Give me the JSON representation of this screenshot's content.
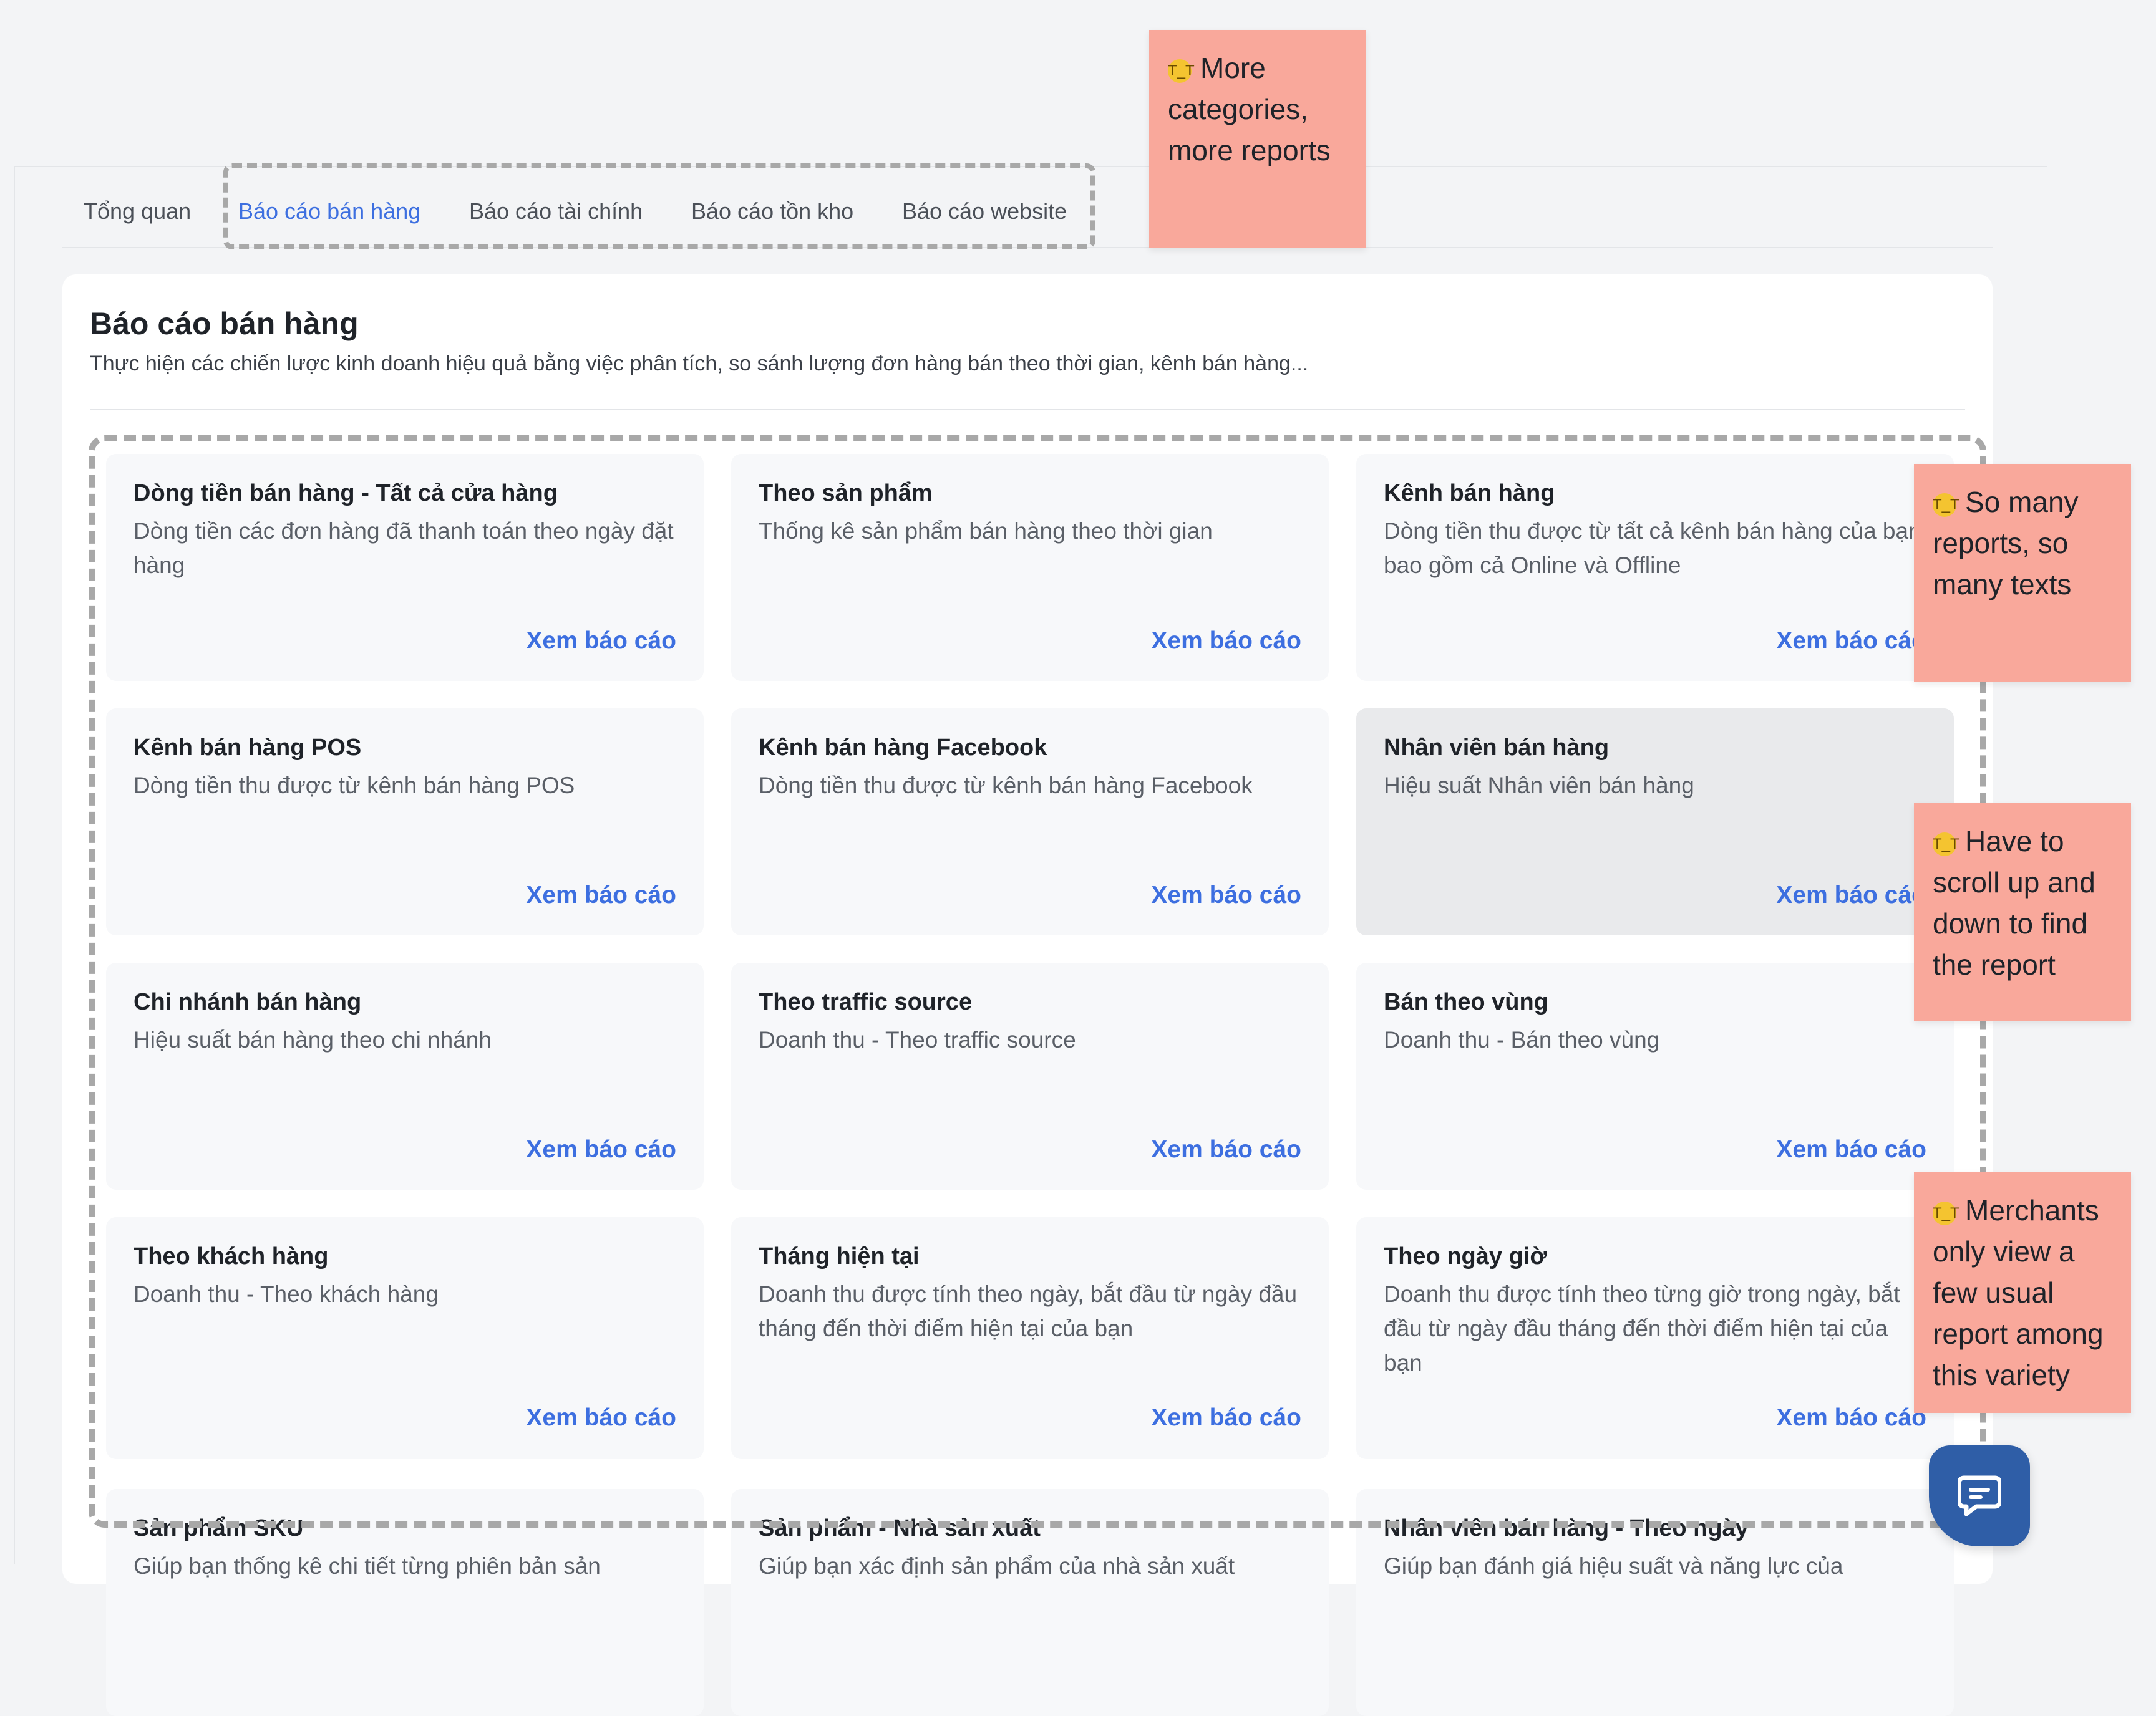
{
  "tabs": [
    {
      "label": "Tổng quan"
    },
    {
      "label": "Báo cáo bán hàng"
    },
    {
      "label": "Báo cáo tài chính"
    },
    {
      "label": "Báo cáo tồn kho"
    },
    {
      "label": "Báo cáo website"
    }
  ],
  "active_tab": "Báo cáo bán hàng",
  "panel": {
    "title": "Báo cáo bán hàng",
    "description": "Thực hiện các chiến lược kinh doanh hiệu quả bằng việc phân tích, so sánh lượng đơn hàng bán theo thời gian, kênh bán hàng..."
  },
  "link_label": "Xem báo cáo",
  "reports": [
    {
      "title": "Dòng tiền bán hàng - Tất cả cửa hàng",
      "desc": "Dòng tiền các đơn hàng đã thanh toán theo ngày đặt hàng"
    },
    {
      "title": "Theo sản phẩm",
      "desc": "Thống kê sản phẩm bán hàng theo thời gian"
    },
    {
      "title": "Kênh bán hàng",
      "desc": "Dòng tiền thu được từ tất cả kênh bán hàng của bạn, bao gồm cả Online và Offline"
    },
    {
      "title": "Kênh bán hàng POS",
      "desc": "Dòng tiền thu được từ kênh bán hàng POS"
    },
    {
      "title": "Kênh bán hàng Facebook",
      "desc": "Dòng tiền thu được từ kênh bán hàng Facebook"
    },
    {
      "title": "Nhân viên bán hàng",
      "desc": "Hiệu suất Nhân viên bán hàng"
    },
    {
      "title": "Chi nhánh bán hàng",
      "desc": "Hiệu suất bán hàng theo chi nhánh"
    },
    {
      "title": "Theo traffic source",
      "desc": "Doanh thu - Theo traffic source"
    },
    {
      "title": "Bán theo vùng",
      "desc": "Doanh thu - Bán theo vùng"
    },
    {
      "title": "Theo khách hàng",
      "desc": "Doanh thu - Theo khách hàng"
    },
    {
      "title": "Tháng hiện tại",
      "desc": "Doanh thu được tính theo ngày, bắt đầu từ ngày đầu tháng đến thời điểm hiện tại của bạn"
    },
    {
      "title": "Theo ngày giờ",
      "desc": "Doanh thu được tính theo từng giờ trong ngày, bắt đầu từ ngày đầu tháng đến thời điểm hiện tại của bạn"
    },
    {
      "title": "Sản phẩm SKU",
      "desc": "Giúp bạn thống kê chi tiết từng phiên bản sản"
    },
    {
      "title": "Sản phẩm - Nhà sản xuất",
      "desc": "Giúp bạn xác định sản phẩm của nhà sản xuất"
    },
    {
      "title": "Nhân viên bán hàng - Theo ngày",
      "desc": "Giúp bạn đánh giá hiệu suất và năng lực của"
    }
  ],
  "notes": [
    {
      "text": "More categories, more reports",
      "icon": "crying-face-icon"
    },
    {
      "text": "So many reports, so many texts",
      "icon": "crying-face-icon"
    },
    {
      "text": "Have to scroll up and down to find the report",
      "icon": "crying-face-icon"
    },
    {
      "text": "Merchants only view a few usual report among this variety",
      "icon": "crying-face-icon"
    }
  ],
  "colors": {
    "accent": "#3d6fe0",
    "sticky_note": "#f9a89b",
    "chat_button": "#2f5ea7"
  }
}
